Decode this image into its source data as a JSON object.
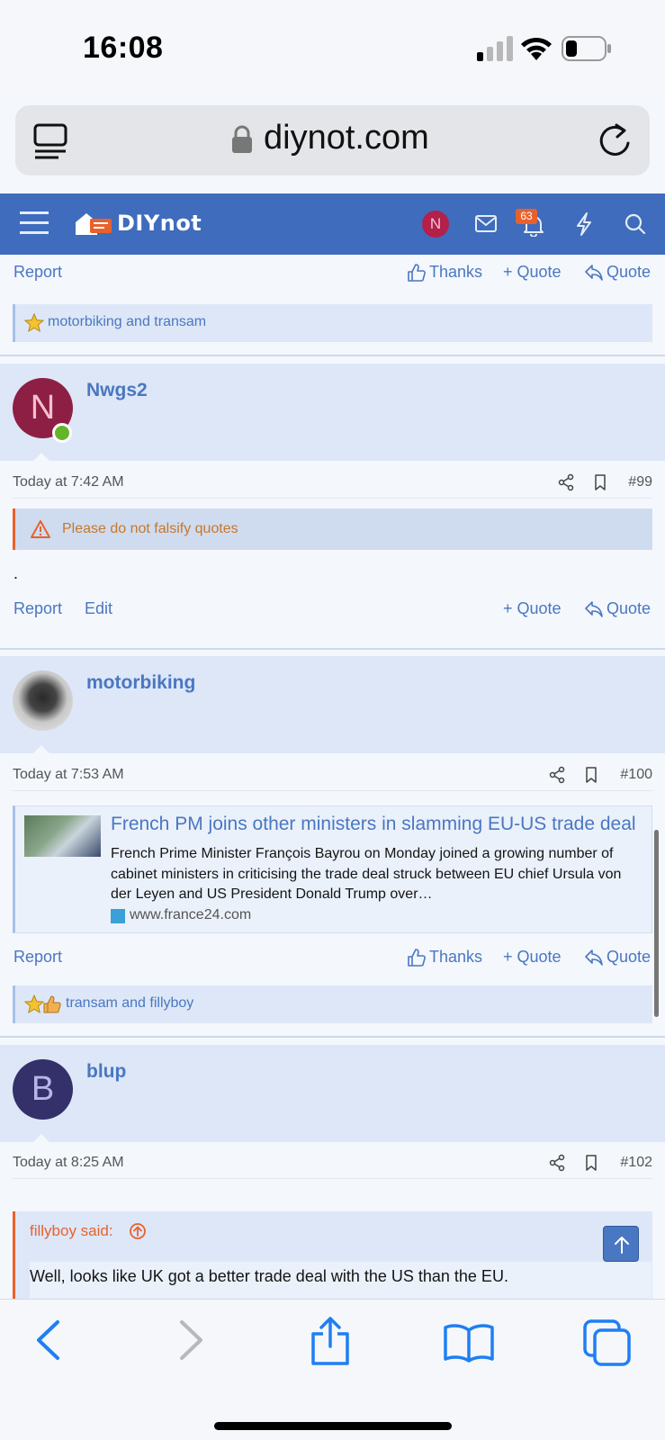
{
  "status_bar": {
    "time": "16:08"
  },
  "browser": {
    "url": "diynot.com"
  },
  "site_nav": {
    "logo_text": "DIYnot",
    "user_initial": "N",
    "alerts_count": "63"
  },
  "actions": {
    "report": "Report",
    "edit": "Edit",
    "thanks": "Thanks",
    "plus_quote": "+ Quote",
    "quote": "Quote"
  },
  "posts": [
    {
      "reactions": "motorbiking and transam"
    },
    {
      "username": "Nwgs2",
      "avatar_initial": "N",
      "date": "Today at 7:42 AM",
      "number": "#99",
      "warning": "Please do not falsify quotes",
      "body": "."
    },
    {
      "username": "motorbiking",
      "date": "Today at 7:53 AM",
      "number": "#100",
      "unfurl": {
        "title": "French PM joins other ministers in slamming EU-US trade deal",
        "description": "French Prime Minister François Bayrou on Monday joined a growing number of cabinet ministers in criticising the trade deal struck between EU chief Ursula von der Leyen and US President Donald Trump over…",
        "domain": "www.france24.com"
      },
      "reactions": "transam and fillyboy"
    },
    {
      "username": "blup",
      "avatar_initial": "B",
      "date": "Today at 8:25 AM",
      "number": "#102",
      "quote_author": "fillyboy said:",
      "quote_text": "Well, looks like UK got a better trade deal with the US than the EU."
    }
  ],
  "colors": {
    "nav_bg": "#3f6cbc",
    "link": "#4a77c2",
    "accent": "#e8612c",
    "header_bg": "#dde7f7"
  }
}
